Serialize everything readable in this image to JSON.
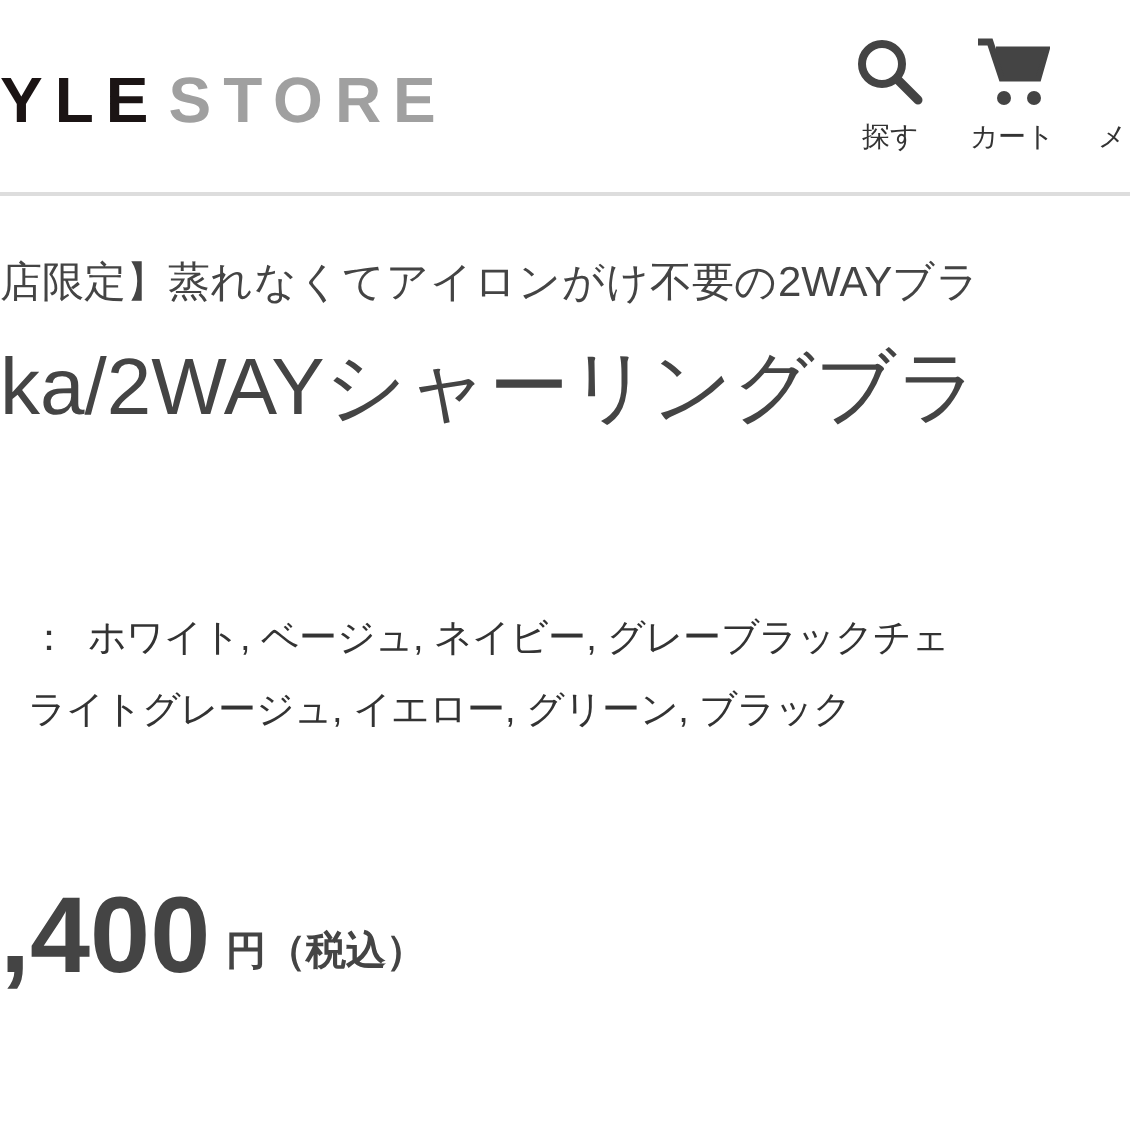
{
  "header": {
    "logo_dark": "YLE",
    "logo_light": "STORE",
    "nav": [
      {
        "kind": "search",
        "label": "探す"
      },
      {
        "kind": "cart",
        "label": "カート"
      },
      {
        "kind": "none",
        "label": "メ"
      }
    ]
  },
  "product": {
    "subtitle": "店限定】蒸れなくてアイロンがけ不要の2WAYブラ",
    "title": "ka/2WAYシャーリングブラ",
    "color_separator": "：",
    "colors": [
      "ホワイト, ベージュ, ネイビー, グレーブラックチェ",
      "ライトグレージュ, イエロー, グリーン, ブラック"
    ],
    "price": ",400",
    "price_unit": "円（税込）"
  }
}
